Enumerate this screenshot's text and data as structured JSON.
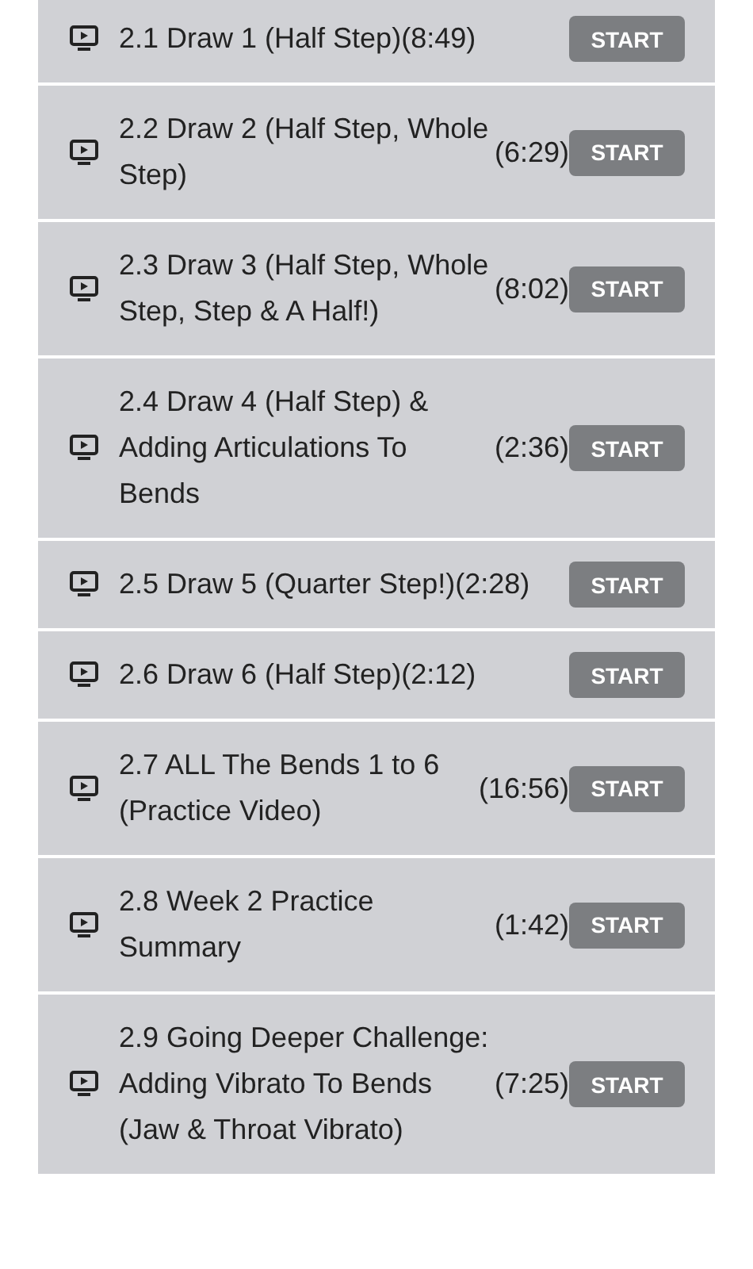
{
  "lessons": [
    {
      "title": "2.1 Draw 1 (Half Step)",
      "duration": "(8:49)",
      "button": "START"
    },
    {
      "title": "2.2 Draw 2 (Half Step, Whole Step)",
      "duration": "(6:29)",
      "button": "START"
    },
    {
      "title": "2.3 Draw 3 (Half Step, Whole Step, Step & A Half!)",
      "duration": "(8:02)",
      "button": "START"
    },
    {
      "title": "2.4 Draw 4 (Half Step) & Adding Articulations To Bends",
      "duration": "(2:36)",
      "button": "START"
    },
    {
      "title": "2.5 Draw 5 (Quarter Step!)",
      "duration": "(2:28)",
      "button": "START"
    },
    {
      "title": "2.6 Draw 6 (Half Step)",
      "duration": "(2:12)",
      "button": "START"
    },
    {
      "title": "2.7 ALL The Bends 1 to 6 (Practice Video)",
      "duration": "(16:56)",
      "button": "START"
    },
    {
      "title": "2.8 Week 2 Practice Summary",
      "duration": "(1:42)",
      "button": "START"
    },
    {
      "title": "2.9 Going Deeper Challenge: Adding Vibrato To Bends (Jaw & Throat Vibrato)",
      "duration": "(7:25)",
      "button": "START"
    }
  ]
}
